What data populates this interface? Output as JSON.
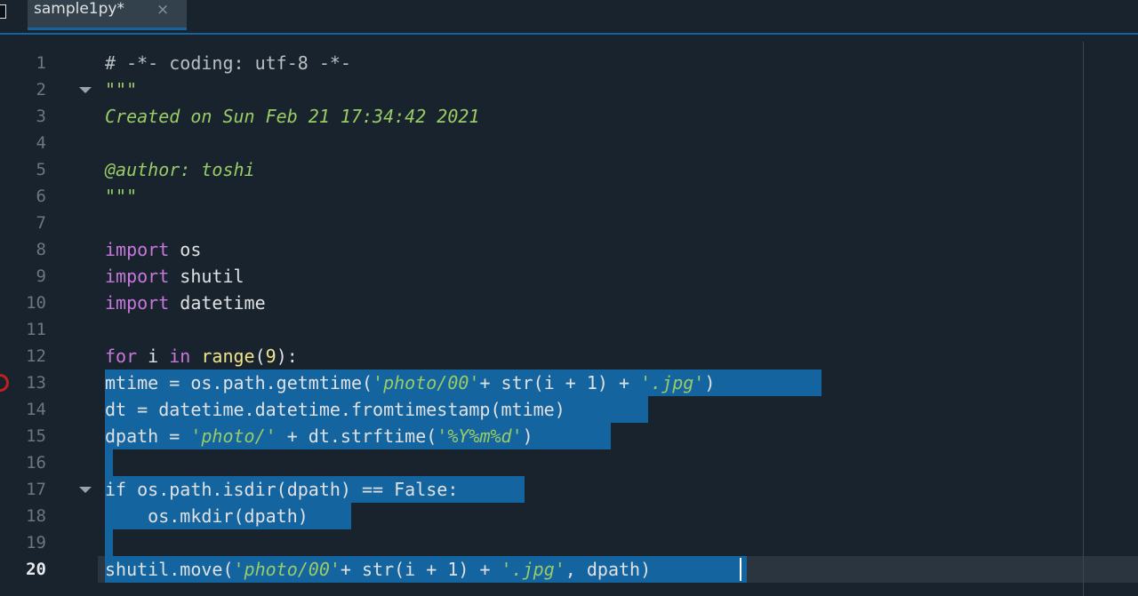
{
  "tab": {
    "label": "sample1py*",
    "close": "×"
  },
  "editor": {
    "line_numbers": [
      "1",
      "2",
      "3",
      "4",
      "5",
      "6",
      "7",
      "8",
      "9",
      "10",
      "11",
      "12",
      "13",
      "14",
      "15",
      "16",
      "17",
      "18",
      "19",
      "20"
    ],
    "current_line": 20,
    "breakpoint_line": 13,
    "fold_lines": [
      2,
      17
    ],
    "lines": [
      [
        {
          "t": "# -*- coding: utf-8 -*-",
          "k": "comment"
        }
      ],
      [
        {
          "t": "\"\"\"",
          "k": "doc"
        }
      ],
      [
        {
          "t": "Created on Sun Feb 21 17:34:42 2021",
          "k": "doc"
        }
      ],
      [],
      [
        {
          "t": "@author: toshi",
          "k": "doc"
        }
      ],
      [
        {
          "t": "\"\"\"",
          "k": "doc"
        }
      ],
      [],
      [
        {
          "t": "import",
          "k": "kw"
        },
        {
          "t": " os",
          "k": "plain"
        }
      ],
      [
        {
          "t": "import",
          "k": "kw"
        },
        {
          "t": " shutil",
          "k": "plain"
        }
      ],
      [
        {
          "t": "import",
          "k": "kw"
        },
        {
          "t": " datetime",
          "k": "plain"
        }
      ],
      [],
      [
        {
          "t": "for",
          "k": "kw"
        },
        {
          "t": " i ",
          "k": "plain"
        },
        {
          "t": "in",
          "k": "kw"
        },
        {
          "t": " ",
          "k": "plain"
        },
        {
          "t": "range",
          "k": "builtin"
        },
        {
          "t": "(",
          "k": "plain"
        },
        {
          "t": "9",
          "k": "num"
        },
        {
          "t": "):",
          "k": "plain"
        }
      ],
      [
        {
          "t": "mtime = os.path.getmtime(",
          "k": "plain"
        },
        {
          "t": "'photo/00'",
          "k": "str"
        },
        {
          "t": "+ str(i + 1) + ",
          "k": "plain"
        },
        {
          "t": "'.jpg'",
          "k": "str"
        },
        {
          "t": ")",
          "k": "plain"
        }
      ],
      [
        {
          "t": "dt = datetime.datetime.fromtimestamp(mtime)",
          "k": "plain"
        }
      ],
      [
        {
          "t": "dpath = ",
          "k": "plain"
        },
        {
          "t": "'photo/'",
          "k": "str"
        },
        {
          "t": " + dt.strftime(",
          "k": "plain"
        },
        {
          "t": "'%Y%m%d'",
          "k": "str"
        },
        {
          "t": ")",
          "k": "plain"
        }
      ],
      [],
      [
        {
          "t": "if os.path.isdir(dpath) == False:",
          "k": "plain"
        }
      ],
      [
        {
          "t": "    os.mkdir(dpath)",
          "k": "plain"
        }
      ],
      [],
      [
        {
          "t": "shutil.move(",
          "k": "plain"
        },
        {
          "t": "'photo/00'",
          "k": "str"
        },
        {
          "t": "+ str(i + 1) + ",
          "k": "plain"
        },
        {
          "t": "'.jpg'",
          "k": "str"
        },
        {
          "t": ", dpath)",
          "k": "plain"
        }
      ]
    ],
    "selected_lines": [
      13,
      20
    ]
  }
}
